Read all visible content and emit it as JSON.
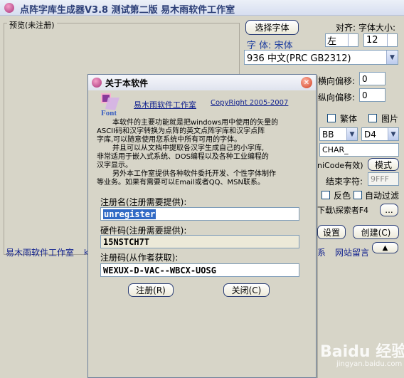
{
  "main_window": {
    "title": "点阵字库生成器V3.8 测试第二版 易木雨软件工作室",
    "preview_label": "预览(未注册)",
    "select_font_button": "选择字体",
    "align_label": "对齐:",
    "font_size_label": "字体大小:",
    "font_label": "字 体: 宋体",
    "align_value": "左",
    "font_size_value": "12",
    "codepage_value": "936 中文(PRC GB2312)",
    "h_offset_label": "横向偏移:",
    "h_offset_value": "0",
    "v_offset_label": "纵向偏移:",
    "v_offset_value": "0",
    "traditional_label": "繁体",
    "image_label": "图片",
    "bits_value": "BB",
    "d_value": "D4",
    "char_value": "CHAR_",
    "unicode_label": "niCode有效)",
    "mode_button": "模式",
    "end_char_label": "结束字符:",
    "end_char_value": "9FFF",
    "invert_label": "反色",
    "auto_filter_label": "自动过滤",
    "download_text": "下载\\探索者F4",
    "small_button": "...",
    "settings_button": "设置",
    "create_button": "创建(C)",
    "footer_left": "易木雨软件工作室",
    "footer_contact": "系",
    "footer_message": "网站留言",
    "up_button": "▲"
  },
  "about_dialog": {
    "title": "关于本软件",
    "studio": "易木雨软件工作室",
    "copyright": "CopyRight 2005-2007",
    "logo_text": "Font",
    "desc_lines": [
      "本软件的主要功能就是把windows用中使用的矢量的",
      "ASCII码和汉字转换为点阵的英文点阵字库和汉字点阵",
      "字库,可以随意使用您系统中所有可用的字体。",
      "并且可以从文档中提取各汉字生成自己的小字库,",
      "非常适用于嵌入式系统、DOS编程以及各种工业编程的",
      "汉字显示。",
      "另外本工作室提供各种软件委托开发、个性字体制作",
      "等业务。如果有需要可以Email或者QQ、MSN联系。"
    ],
    "reg_name_label": "注册名(注册需要提供):",
    "reg_name_value": "unregister",
    "hw_code_label": "硬件码(注册需要提供):",
    "hw_code_value": "15NSTCH7T",
    "reg_code_label": "注册码(从作者获取):",
    "reg_code_value": "WEXUX-D-VAC--WBCX-UOSG",
    "register_button": "注册(R)",
    "close_button": "关闭(C)"
  },
  "watermark": {
    "text": "Baidu 经验",
    "url": "jingyan.baidu.com"
  }
}
